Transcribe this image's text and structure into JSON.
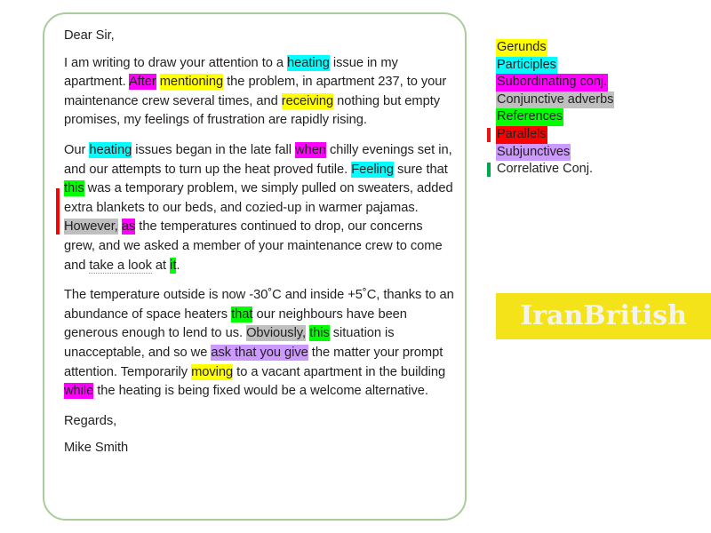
{
  "letter": {
    "salutation": "Dear Sir,",
    "paragraphs": [
      {
        "id": "para-1",
        "runs": [
          {
            "t": "I am writing to draw your attention to a "
          },
          {
            "t": "heating",
            "h": "participle"
          },
          {
            "t": " issue in my apartment. "
          },
          {
            "t": "After",
            "h": "subord"
          },
          {
            "t": " "
          },
          {
            "t": "mentioning",
            "h": "gerund"
          },
          {
            "t": " the problem, in apartment 237, to your maintenance crew several times, and "
          },
          {
            "t": "receiving",
            "h": "gerund"
          },
          {
            "t": " nothing but empty promises, my feelings of frustration are rapidly rising."
          }
        ]
      },
      {
        "id": "para-2",
        "runs": [
          {
            "t": "Our "
          },
          {
            "t": "heating",
            "h": "participle"
          },
          {
            "t": " issues began in the late fall "
          },
          {
            "t": "when",
            "h": "subord"
          },
          {
            "t": " chilly evenings set in, and our attempts to turn up the heat proved futile. "
          },
          {
            "t": "Feeling",
            "h": "participle"
          },
          {
            "t": " sure that "
          },
          {
            "t": "this",
            "h": "reference"
          },
          {
            "t": " was a temporary problem, we simply pulled on sweaters, added extra blankets to our beds, and cozied-up in warmer pajamas. "
          },
          {
            "t": "However,",
            "h": "conjadv"
          },
          {
            "t": " "
          },
          {
            "t": "as",
            "h": "subord"
          },
          {
            "t": " the temperatures continued to drop, our concerns grew, and we asked a member of your maintenance crew to come and "
          },
          {
            "t": "take a look",
            "u": "dotted"
          },
          {
            "t": " at "
          },
          {
            "t": "it",
            "h": "reference"
          },
          {
            "t": "."
          }
        ]
      },
      {
        "id": "para-3",
        "runs": [
          {
            "t": "The temperature outside is now -30˚C and inside +5˚C, thanks to an abundance of space heaters "
          },
          {
            "t": "that",
            "h": "reference"
          },
          {
            "t": " our neighbours have been generous enough to lend to us. "
          },
          {
            "t": "Obviously,",
            "h": "conjadv"
          },
          {
            "t": " "
          },
          {
            "t": "this",
            "h": "reference"
          },
          {
            "t": " situation is unacceptable, and so we "
          },
          {
            "t": "ask that you give",
            "h": "subjunctive"
          },
          {
            "t": " the matter your prompt attention. Temporarily "
          },
          {
            "t": "moving",
            "h": "gerund"
          },
          {
            "t": " to a vacant apartment in the building "
          },
          {
            "t": "while",
            "h": "subord"
          },
          {
            "t": " the heating is being fixed would be a welcome alternative."
          }
        ]
      }
    ],
    "closing": "Regards,",
    "signature": "Mike Smith"
  },
  "legend": {
    "items": [
      {
        "label": "Gerunds",
        "highlight": "gerund",
        "marker": "none"
      },
      {
        "label": "Participles",
        "highlight": "participle",
        "marker": "none"
      },
      {
        "label": "Subordinating conj.",
        "highlight": "subord",
        "marker": "none"
      },
      {
        "label": "Conjunctive adverbs",
        "highlight": "conjadv",
        "marker": "none"
      },
      {
        "label": "References",
        "highlight": "reference",
        "marker": "none"
      },
      {
        "label": "Parallels",
        "highlight": "parallel",
        "marker": "red"
      },
      {
        "label": "Subjunctives",
        "highlight": "subjunctive",
        "marker": "none"
      },
      {
        "label": "Correlative Conj.",
        "highlight": "none",
        "marker": "green"
      }
    ]
  },
  "brand": {
    "name": "IranBritish"
  },
  "colors": {
    "gerund": "#ffff00",
    "participle": "#00ffff",
    "subord": "#ff00ff",
    "conjadv": "#bfbfbf",
    "reference": "#00ff00",
    "parallel": "#ff0000",
    "subjunctive": "#cc99ff",
    "marker_red": "#ee1111",
    "marker_green": "#00a550",
    "card_border": "#a9cd9a",
    "brand_bg": "#f5e31a",
    "brand_fg": "#f4f4ee",
    "spellcheck_underline": "#c8883c"
  }
}
